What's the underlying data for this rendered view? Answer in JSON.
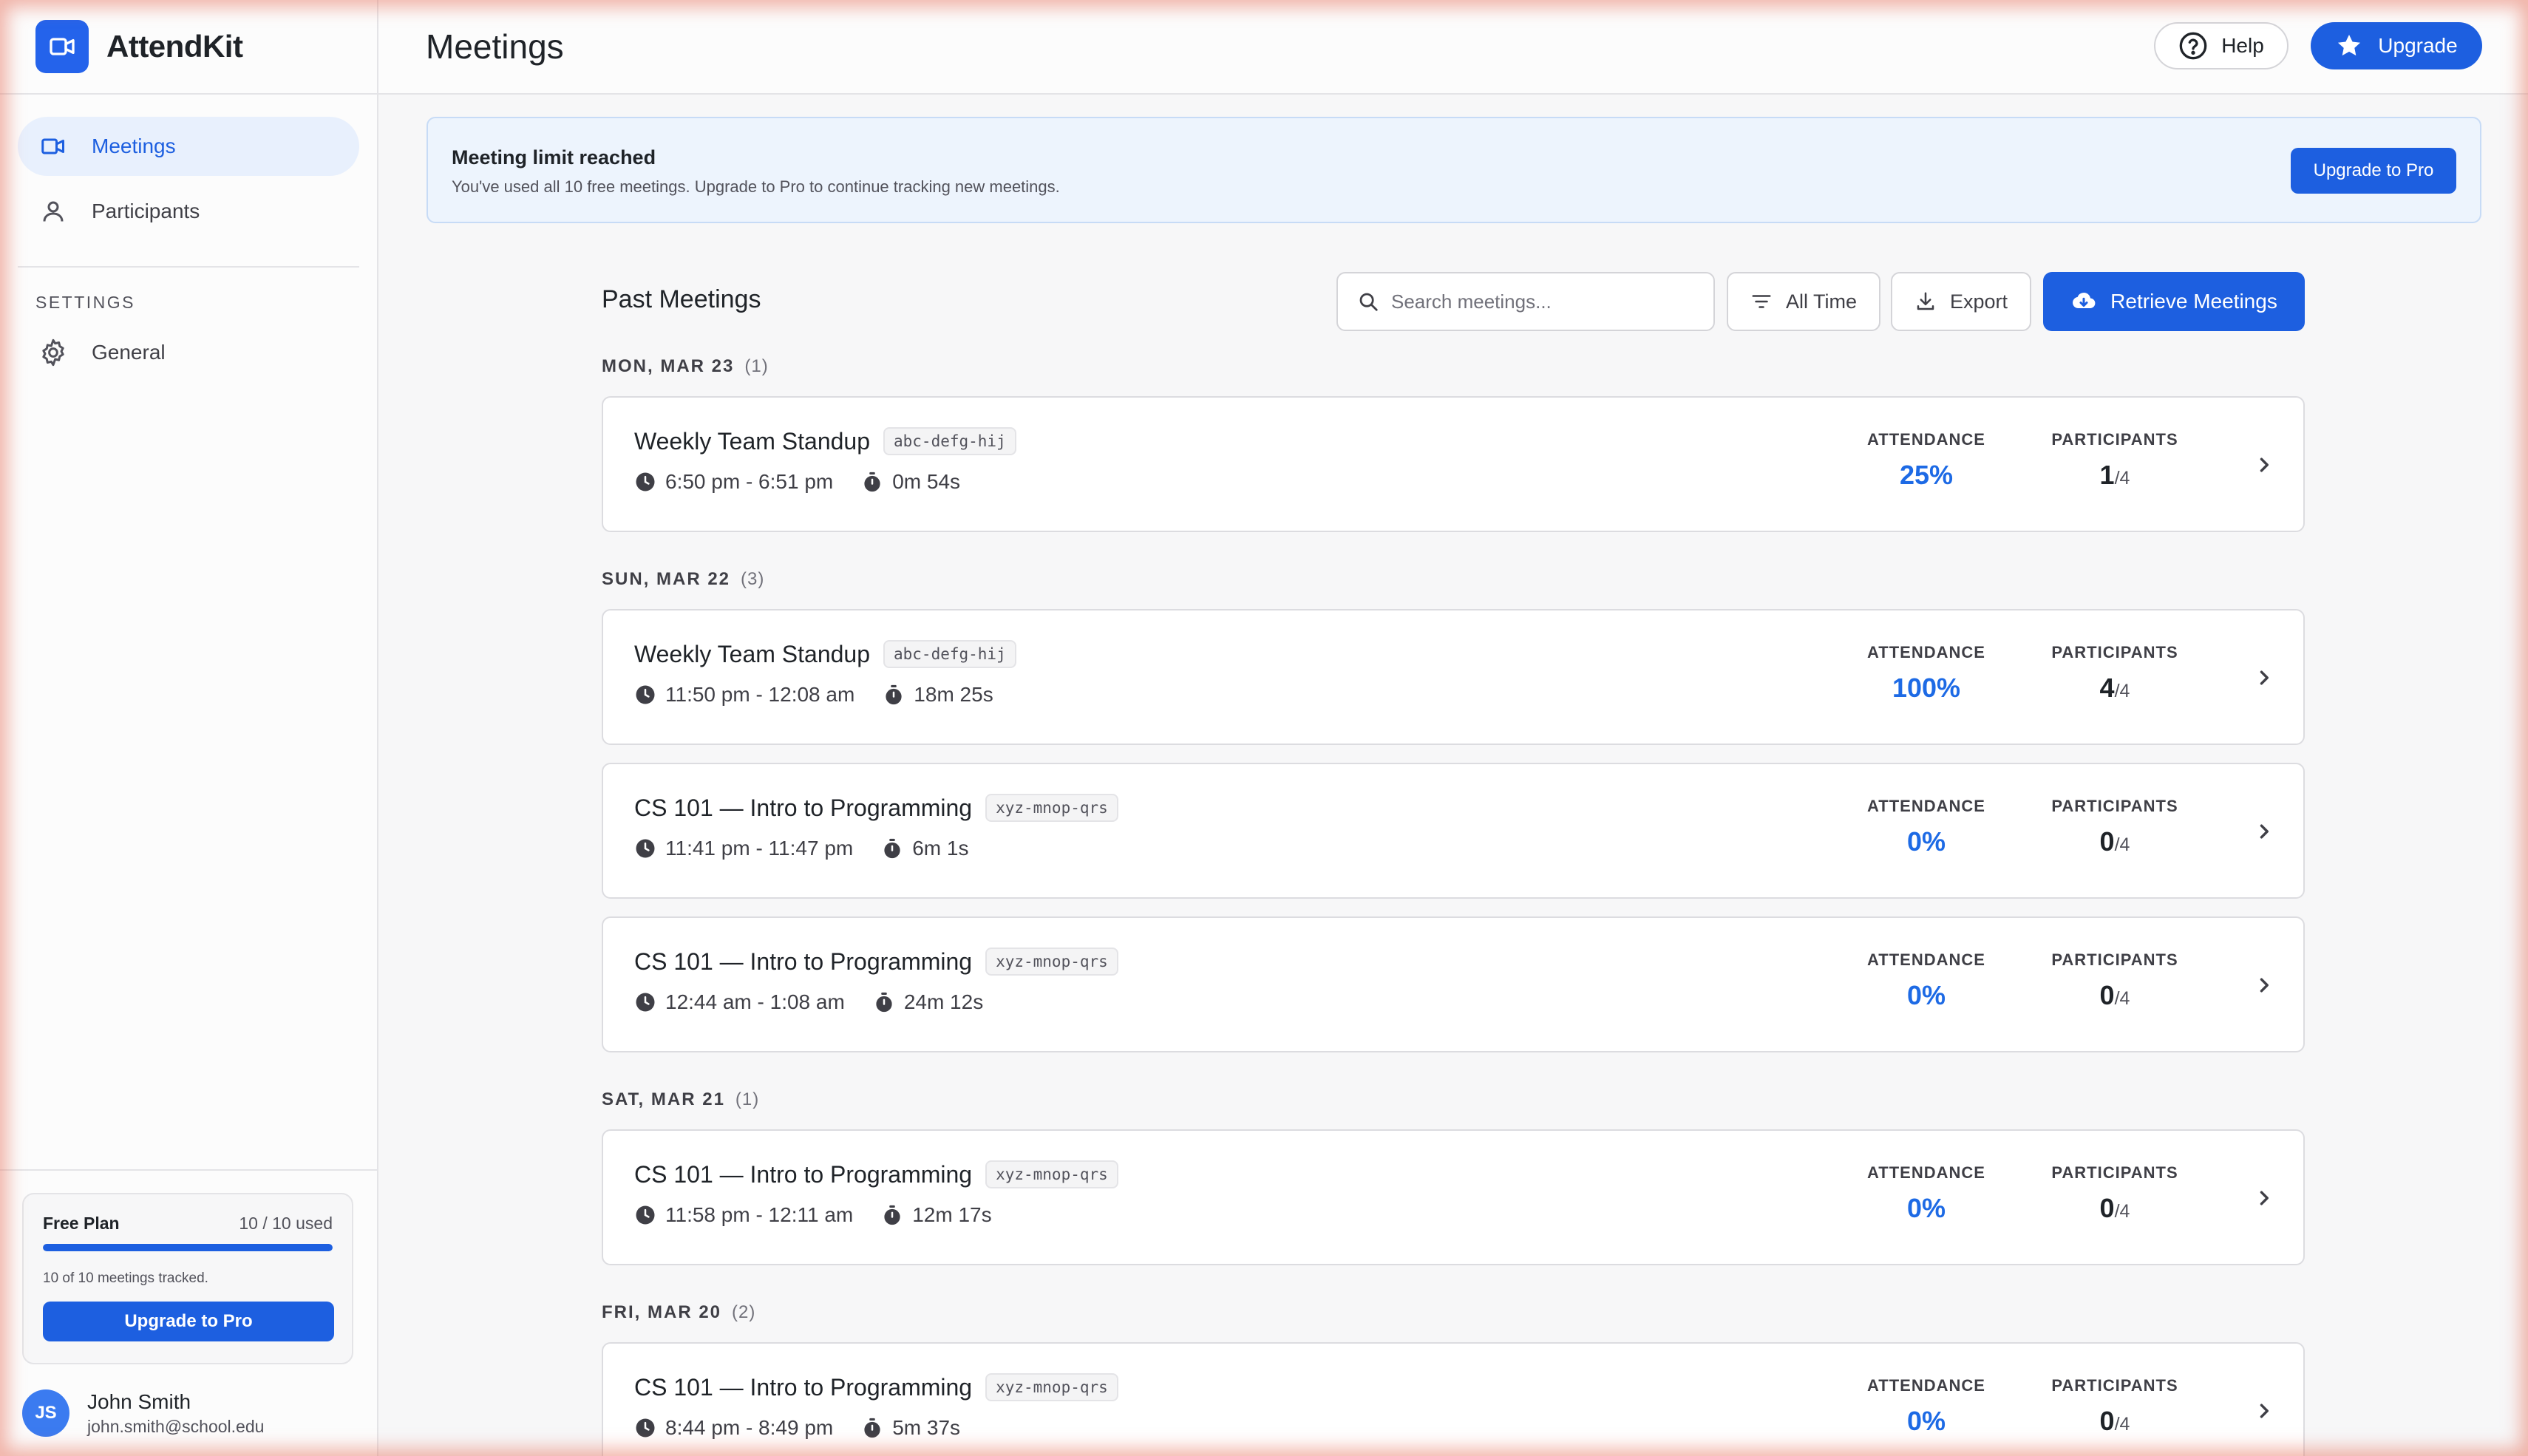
{
  "app": {
    "name": "AttendKit"
  },
  "sidebar": {
    "nav": [
      {
        "label": "Meetings",
        "icon": "video-camera-icon",
        "active": true
      },
      {
        "label": "Participants",
        "icon": "person-icon",
        "active": false
      }
    ],
    "settings_label": "SETTINGS",
    "settings_items": [
      {
        "label": "General",
        "icon": "gear-icon"
      }
    ],
    "plan": {
      "name": "Free Plan",
      "used_text": "10 / 10 used",
      "used_fraction": 1.0,
      "note": "10 of 10 meetings tracked.",
      "button": "Upgrade to Pro"
    },
    "user": {
      "initials": "JS",
      "name": "John Smith",
      "email": "john.smith@school.edu"
    }
  },
  "header": {
    "title": "Meetings",
    "help_label": "Help",
    "upgrade_label": "Upgrade"
  },
  "banner": {
    "title": "Meeting limit reached",
    "description": "You've used all 10 free meetings. Upgrade to Pro to continue tracking new meetings.",
    "button": "Upgrade to Pro"
  },
  "meetings": {
    "title": "Past Meetings",
    "search_placeholder": "Search meetings...",
    "filter_label": "All Time",
    "export_label": "Export",
    "retrieve_label": "Retrieve Meetings",
    "attendance_label": "ATTENDANCE",
    "participants_label": "PARTICIPANTS",
    "groups": [
      {
        "date": "MON, MAR 23",
        "count": "(1)",
        "items": [
          {
            "title": "Weekly Team Standup",
            "code": "abc-defg-hij",
            "time": "6:50 pm - 6:51 pm",
            "duration": "0m 54s",
            "attendance": "25%",
            "participants": "1",
            "total": "/4"
          }
        ]
      },
      {
        "date": "SUN, MAR 22",
        "count": "(3)",
        "items": [
          {
            "title": "Weekly Team Standup",
            "code": "abc-defg-hij",
            "time": "11:50 pm - 12:08 am",
            "duration": "18m 25s",
            "attendance": "100%",
            "participants": "4",
            "total": "/4"
          },
          {
            "title": "CS 101 — Intro to Programming",
            "code": "xyz-mnop-qrs",
            "time": "11:41 pm - 11:47 pm",
            "duration": "6m 1s",
            "attendance": "0%",
            "participants": "0",
            "total": "/4"
          },
          {
            "title": "CS 101 — Intro to Programming",
            "code": "xyz-mnop-qrs",
            "time": "12:44 am - 1:08 am",
            "duration": "24m 12s",
            "attendance": "0%",
            "participants": "0",
            "total": "/4"
          }
        ]
      },
      {
        "date": "SAT, MAR 21",
        "count": "(1)",
        "items": [
          {
            "title": "CS 101 — Intro to Programming",
            "code": "xyz-mnop-qrs",
            "time": "11:58 pm - 12:11 am",
            "duration": "12m 17s",
            "attendance": "0%",
            "participants": "0",
            "total": "/4"
          }
        ]
      },
      {
        "date": "FRI, MAR 20",
        "count": "(2)",
        "items": [
          {
            "title": "CS 101 — Intro to Programming",
            "code": "xyz-mnop-qrs",
            "time": "8:44 pm - 8:49 pm",
            "duration": "5m 37s",
            "attendance": "0%",
            "participants": "0",
            "total": "/4"
          }
        ]
      }
    ]
  },
  "colors": {
    "accent": "#1d5fe0",
    "attendance": "#1d6ae5",
    "banner_bg": "#edf4fd"
  }
}
